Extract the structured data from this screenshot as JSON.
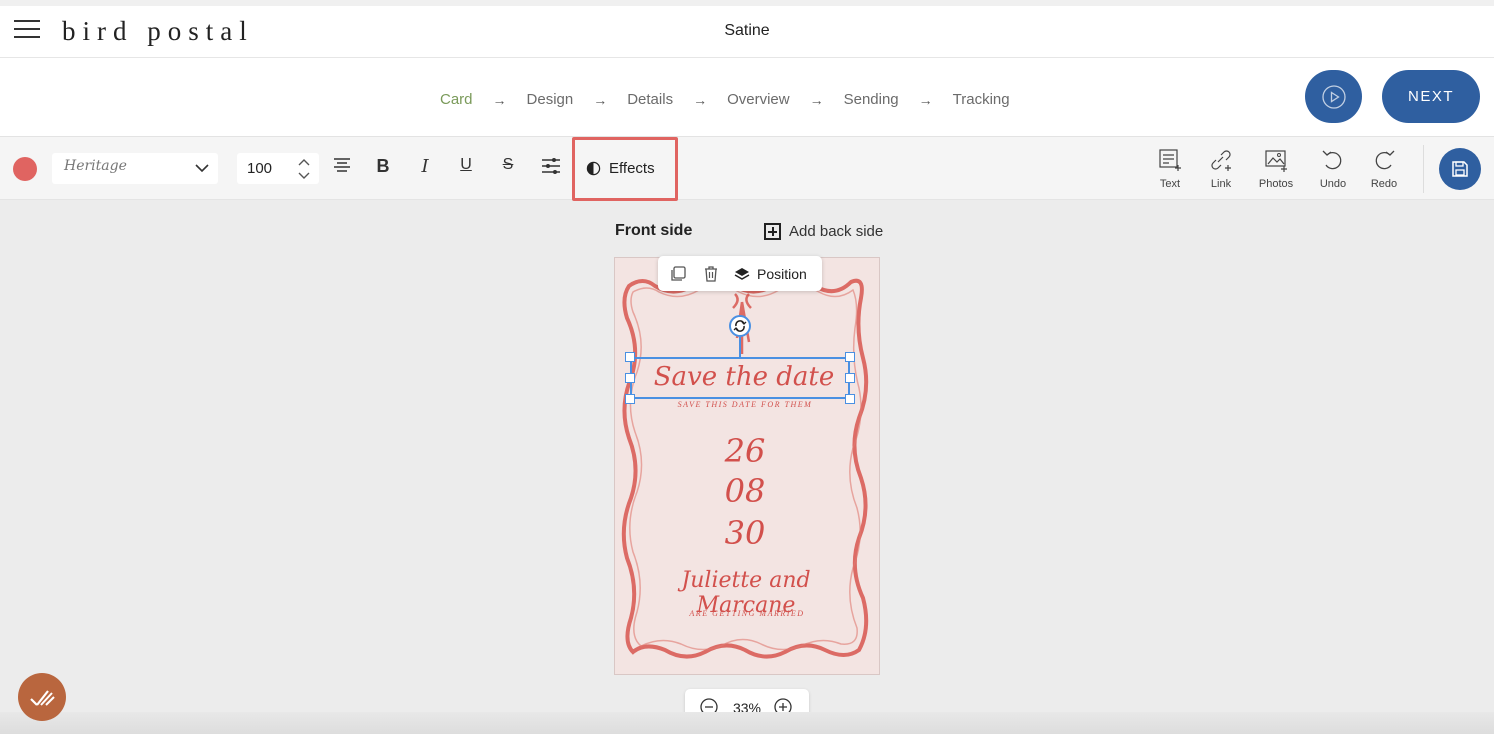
{
  "header": {
    "logo": "bird postal",
    "doc_title": "Satine"
  },
  "steps": [
    {
      "label": "Card",
      "active": true
    },
    {
      "label": "Design",
      "active": false
    },
    {
      "label": "Details",
      "active": false
    },
    {
      "label": "Overview",
      "active": false
    },
    {
      "label": "Sending",
      "active": false
    },
    {
      "label": "Tracking",
      "active": false
    }
  ],
  "actions": {
    "next_label": "NEXT"
  },
  "toolbar": {
    "text_color": "#e06461",
    "font_preview": "Heritage",
    "font_size": "100",
    "effects_label": "Effects",
    "text_label": "Text",
    "link_label": "Link",
    "photos_label": "Photos",
    "undo_label": "Undo",
    "redo_label": "Redo"
  },
  "canvas": {
    "side_label": "Front side",
    "add_back_label": "Add back side",
    "context_position_label": "Position",
    "zoom_level": "33%"
  },
  "card": {
    "title": "Save the date",
    "subtitle": "SAVE THIS DATE FOR THEM",
    "day": "26",
    "month": "08",
    "year": "30",
    "names": "Juliette and Marcane",
    "tagline": "ARE GETTING MARRIED"
  },
  "colors": {
    "accent_blue": "#2f5fa0",
    "active_step": "#7a9a5a",
    "card_ink": "#d2504c",
    "highlight": "#e06461"
  }
}
